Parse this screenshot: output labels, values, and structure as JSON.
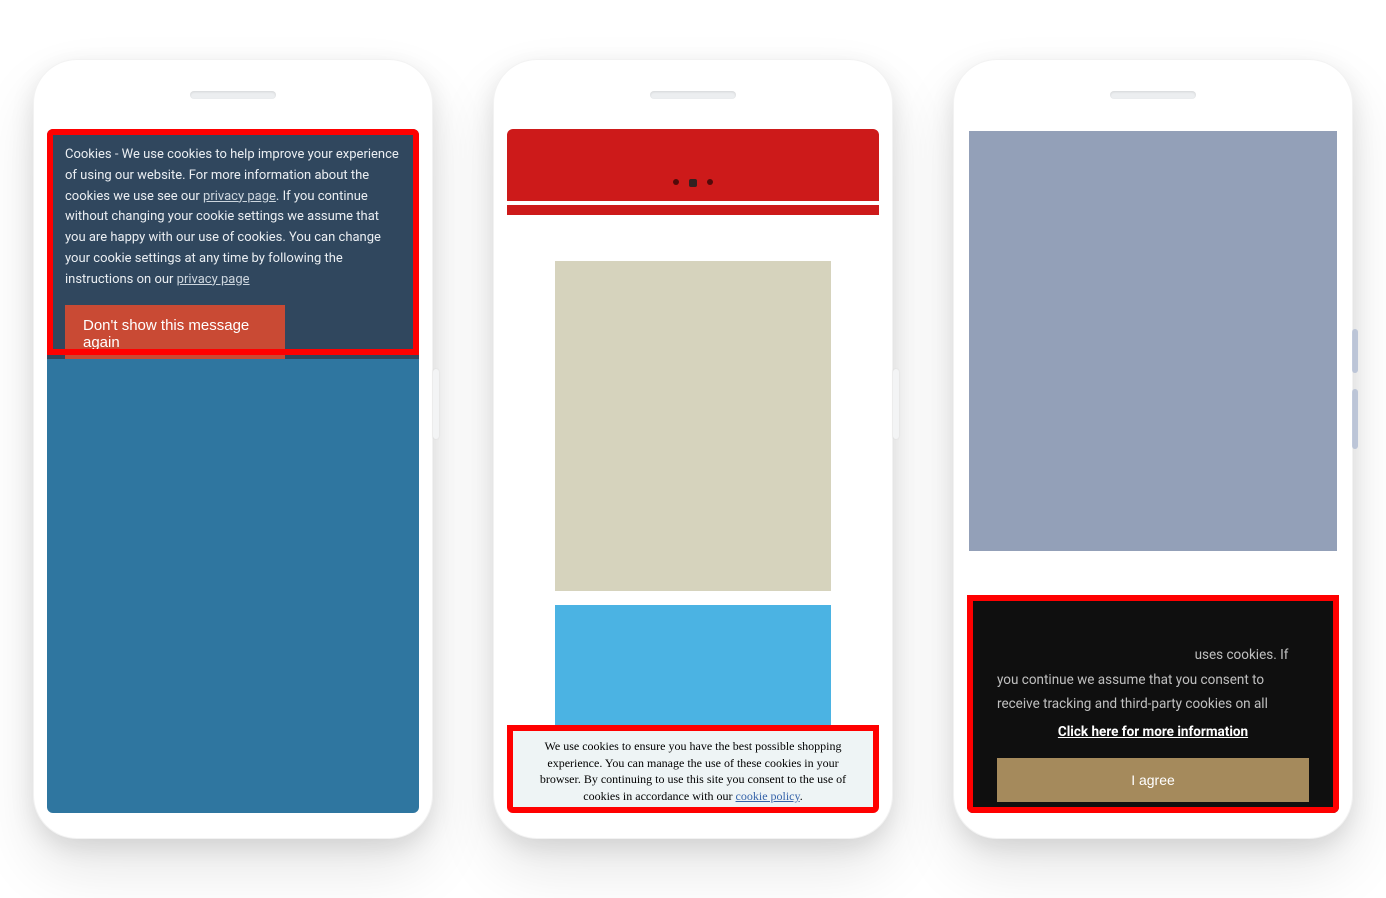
{
  "phone1": {
    "cookie_text_pre": "Cookies - We use cookies to help improve your experience of using our website. For more information about the cookies we use see our ",
    "privacy_link_1": "privacy page",
    "cookie_text_mid": ". If you continue without changing your cookie settings we assume that you are happy with our use of cookies. You can change your cookie settings at any time by following the instructions on our ",
    "privacy_link_2": "privacy page",
    "dismiss_button": "Don't show this message again"
  },
  "phone2": {
    "cookie_text_pre": "We use cookies to ensure you have the best possible shopping experience. You can manage the use of these cookies in your browser. By continuing to use this site you consent to the use of cookies in accordance with our ",
    "policy_link": "cookie policy",
    "policy_suffix": "."
  },
  "phone3": {
    "cookie_text": "uses cookies. If you continue we assume that you consent to receive tracking and third-party cookies on all",
    "more_link": "Click here for more information",
    "agree_button": "I agree"
  }
}
